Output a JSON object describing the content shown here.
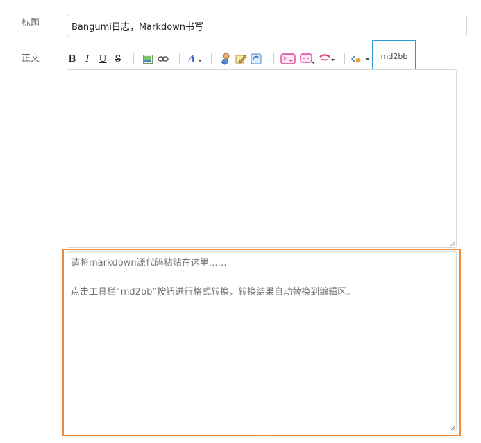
{
  "form": {
    "title_label": "标题",
    "title_value": "Bangumi日志，Markdown书写",
    "body_label": "正文"
  },
  "toolbar": {
    "bold": "B",
    "italic": "I",
    "underline": "U",
    "strike": "S",
    "md2bb_label": "md2bb",
    "icons": [
      "image-icon",
      "link-icon",
      "font-color-icon",
      "quote-icon",
      "edit-icon",
      "refresh-icon",
      "emoji-icon",
      "chat-icon",
      "smiley-icon",
      "code-icon"
    ]
  },
  "markdown_input": {
    "placeholder": "请将markdown源代码粘贴在这里……\n\n点击工具栏“md2bb”按钮进行格式转换，转换结果自动替换到编辑区。"
  },
  "colors": {
    "highlight_blue": "#2a9ad8",
    "highlight_orange": "#ef8a3c"
  }
}
